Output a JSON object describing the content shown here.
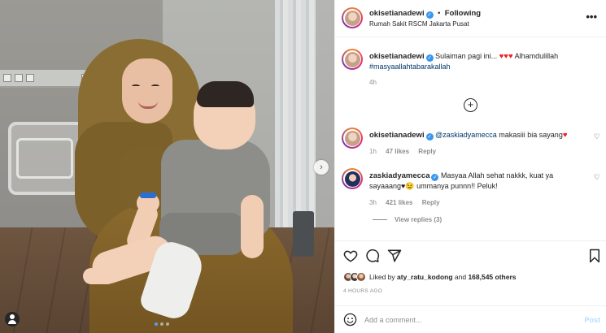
{
  "post": {
    "username": "okisetianadewi",
    "follow_status": "Following",
    "separator": "•",
    "location": "Rumah Sakit RSCM Jakarta Pusat",
    "more_icon": "more-options-icon",
    "more_glyph": "•••"
  },
  "caption": {
    "username": "okisetianadewi",
    "text": "Sulaiman pagi ini... ",
    "text_after": " Alhamdulillah",
    "hashtag": "#masyaallahtabarakallah",
    "time": "4h"
  },
  "add_comment_glyph": "+",
  "comments": [
    {
      "username": "okisetianadewi",
      "mention": "@zaskiadyamecca",
      "text": " makasiii bia sayang",
      "time": "1h",
      "likes": "47 likes",
      "reply": "Reply"
    },
    {
      "username": "zaskiadyamecca",
      "text": "Masyaa Allah sehat nakkk, kuat ya sayaaang♥😉 ummanya punnn!! Peluk!",
      "time": "3h",
      "likes": "421 likes",
      "reply": "Reply"
    }
  ],
  "view_replies": "View replies (3)",
  "likes": {
    "prefix": "Liked by ",
    "user": "aty_ratu_kodong",
    "mid": " and ",
    "count": "168,545 others"
  },
  "timestamp": "4 HOURS AGO",
  "composer": {
    "placeholder": "Add a comment...",
    "post_label": "Post"
  },
  "carousel": {
    "next_glyph": "›",
    "slides": 3,
    "active_index": 0
  },
  "colors": {
    "verified": "#3897f0",
    "link": "#00376b",
    "heart": "#ed1c24",
    "post_disabled": "#b2dffc"
  }
}
